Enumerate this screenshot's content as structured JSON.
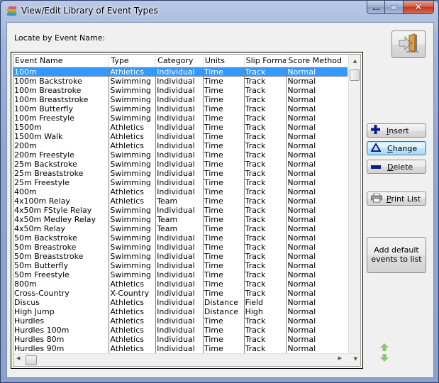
{
  "window": {
    "title": "View/Edit Library of Event Types",
    "icon": "books-stack-icon",
    "caption_buttons": [
      "minimize",
      "maximize",
      "close"
    ]
  },
  "locate": {
    "label": "Locate by Event Name:"
  },
  "grid": {
    "columns": [
      "Event Name",
      "Type",
      "Category",
      "Units",
      "Slip Format",
      "Score Method"
    ],
    "selected_index": 0,
    "rows": [
      [
        "100m",
        "Athletics",
        "Individual",
        "Time",
        "Track",
        "Normal"
      ],
      [
        "100m Backstroke",
        "Swimming",
        "Individual",
        "Time",
        "Track",
        "Normal"
      ],
      [
        "100m Breastroke",
        "Swimming",
        "Individual",
        "Time",
        "Track",
        "Normal"
      ],
      [
        "100m Breaststroke",
        "Swimming",
        "Individual",
        "Time",
        "Track",
        "Normal"
      ],
      [
        "100m Butterfly",
        "Swimming",
        "Individual",
        "Time",
        "Track",
        "Normal"
      ],
      [
        "100m Freestyle",
        "Swimming",
        "Individual",
        "Time",
        "Track",
        "Normal"
      ],
      [
        "1500m",
        "Athletics",
        "Individual",
        "Time",
        "Track",
        "Normal"
      ],
      [
        "1500m Walk",
        "Athletics",
        "Individual",
        "Time",
        "Track",
        "Normal"
      ],
      [
        "200m",
        "Athletics",
        "Individual",
        "Time",
        "Track",
        "Normal"
      ],
      [
        "200m Freestyle",
        "Swimming",
        "Individual",
        "Time",
        "Track",
        "Normal"
      ],
      [
        "25m Backstroke",
        "Swimming",
        "Individual",
        "Time",
        "Track",
        "Normal"
      ],
      [
        "25m Breaststroke",
        "Swimming",
        "Individual",
        "Time",
        "Track",
        "Normal"
      ],
      [
        "25m Freestyle",
        "Swimming",
        "Individual",
        "Time",
        "Track",
        "Normal"
      ],
      [
        "400m",
        "Athletics",
        "Individual",
        "Time",
        "Track",
        "Normal"
      ],
      [
        "4x100m Relay",
        "Athletics",
        "Team",
        "Time",
        "Track",
        "Normal"
      ],
      [
        "4x50m FStyle Relay",
        "Swimming",
        "Individual",
        "Time",
        "Track",
        "Normal"
      ],
      [
        "4x50m Medley Relay",
        "Swimming",
        "Team",
        "Time",
        "Track",
        "Normal"
      ],
      [
        "4x50m Relay",
        "Swimming",
        "Team",
        "Time",
        "Track",
        "Normal"
      ],
      [
        "50m Backstroke",
        "Swimming",
        "Individual",
        "Time",
        "Track",
        "Normal"
      ],
      [
        "50m Breastroke",
        "Swimming",
        "Individual",
        "Time",
        "Track",
        "Normal"
      ],
      [
        "50m Breaststroke",
        "Swimming",
        "Individual",
        "Time",
        "Track",
        "Normal"
      ],
      [
        "50m Butterfly",
        "Swimming",
        "Individual",
        "Time",
        "Track",
        "Normal"
      ],
      [
        "50m Freestyle",
        "Swimming",
        "Individual",
        "Time",
        "Track",
        "Normal"
      ],
      [
        "800m",
        "Athletics",
        "Individual",
        "Time",
        "Track",
        "Normal"
      ],
      [
        "Cross-Country",
        "X-Country",
        "Individual",
        "Time",
        "Track",
        "Normal"
      ],
      [
        "Discus",
        "Athletics",
        "Individual",
        "Distance",
        "Field",
        "Normal"
      ],
      [
        "High Jump",
        "Athletics",
        "Individual",
        "Distance",
        "High",
        "Normal"
      ],
      [
        "Hurdles",
        "Athletics",
        "Individual",
        "Time",
        "Track",
        "Normal"
      ],
      [
        "Hurdles 100m",
        "Athletics",
        "Individual",
        "Time",
        "Track",
        "Normal"
      ],
      [
        "Hurdles 80m",
        "Athletics",
        "Individual",
        "Time",
        "Track",
        "Normal"
      ],
      [
        "Hurdles 90m",
        "Athletics",
        "Individual",
        "Time",
        "Track",
        "Normal"
      ]
    ]
  },
  "buttons": {
    "exit": {
      "icon": "exit-door-icon"
    },
    "insert": {
      "label": "Insert",
      "accel": "I",
      "rest": "nsert",
      "icon": "plus-icon"
    },
    "change": {
      "label": "Change",
      "accel": "C",
      "rest": "hange",
      "icon": "triangle-icon"
    },
    "delete": {
      "label": "Delete",
      "accel": "D",
      "rest": "elete",
      "icon": "minus-icon"
    },
    "print_list": {
      "label": "Print List",
      "accel": "P",
      "rest": "rint List",
      "icon": "printer-icon"
    },
    "add_default": {
      "line1": "Add default",
      "line2": "events to list"
    }
  },
  "colors": {
    "selection": "#3399ff",
    "button_icon_blue": "#0a1f8f",
    "resize_arrows": "#86c96b"
  }
}
